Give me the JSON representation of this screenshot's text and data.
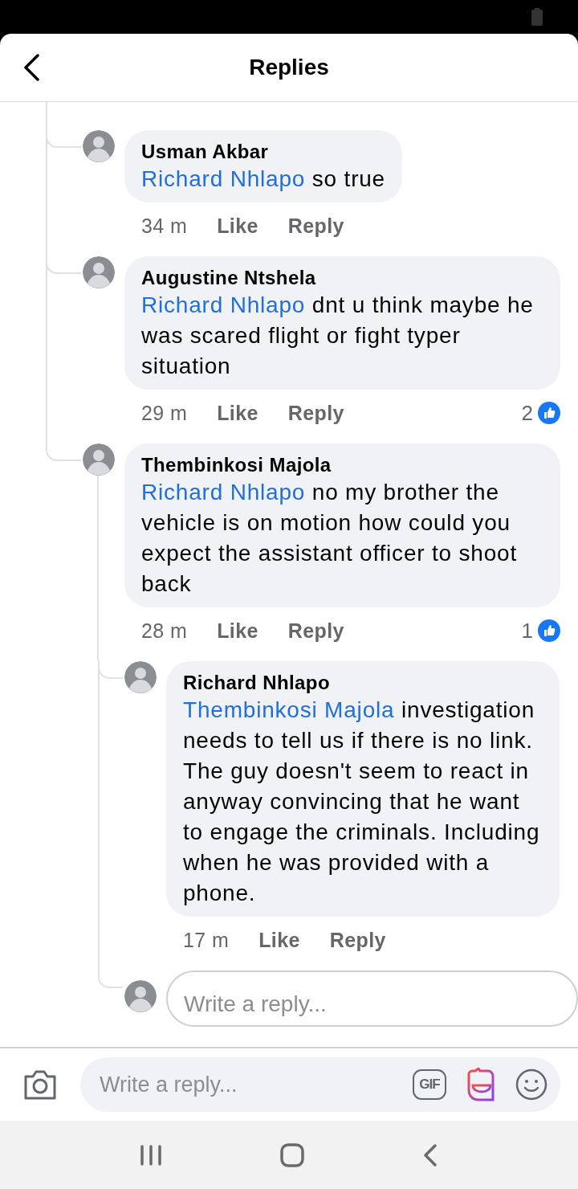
{
  "header": {
    "title": "Replies"
  },
  "comments": [
    {
      "author": "Usman Akbar",
      "mention": "Richard Nhlapo",
      "text": "so true",
      "time": "34 m",
      "like": "Like",
      "reply": "Reply"
    },
    {
      "author": "Augustine Ntshela",
      "mention": "Richard Nhlapo",
      "text": "dnt u think maybe he was scared flight or fight typer situation",
      "time": "29 m",
      "like": "Like",
      "reply": "Reply",
      "likes": "2"
    },
    {
      "author": "Thembinkosi Majola",
      "mention": "Richard Nhlapo",
      "text": "no my brother the vehicle is on motion how could you expect the assistant officer to shoot back",
      "time": "28 m",
      "like": "Like",
      "reply": "Reply",
      "likes": "1",
      "replies": [
        {
          "author": "Richard Nhlapo",
          "mention": "Thembinkosi Majola",
          "text": "investigation needs to tell us if there is no link. The guy doesn't seem to react in anyway convincing that he want to engage the criminals. Including when he was provided with a phone.",
          "time": "17 m",
          "like": "Like",
          "reply": "Reply"
        }
      ],
      "reply_field": {
        "placeholder": "Write a reply..."
      }
    }
  ],
  "composer": {
    "placeholder": "Write a reply...",
    "gif": "GIF"
  }
}
